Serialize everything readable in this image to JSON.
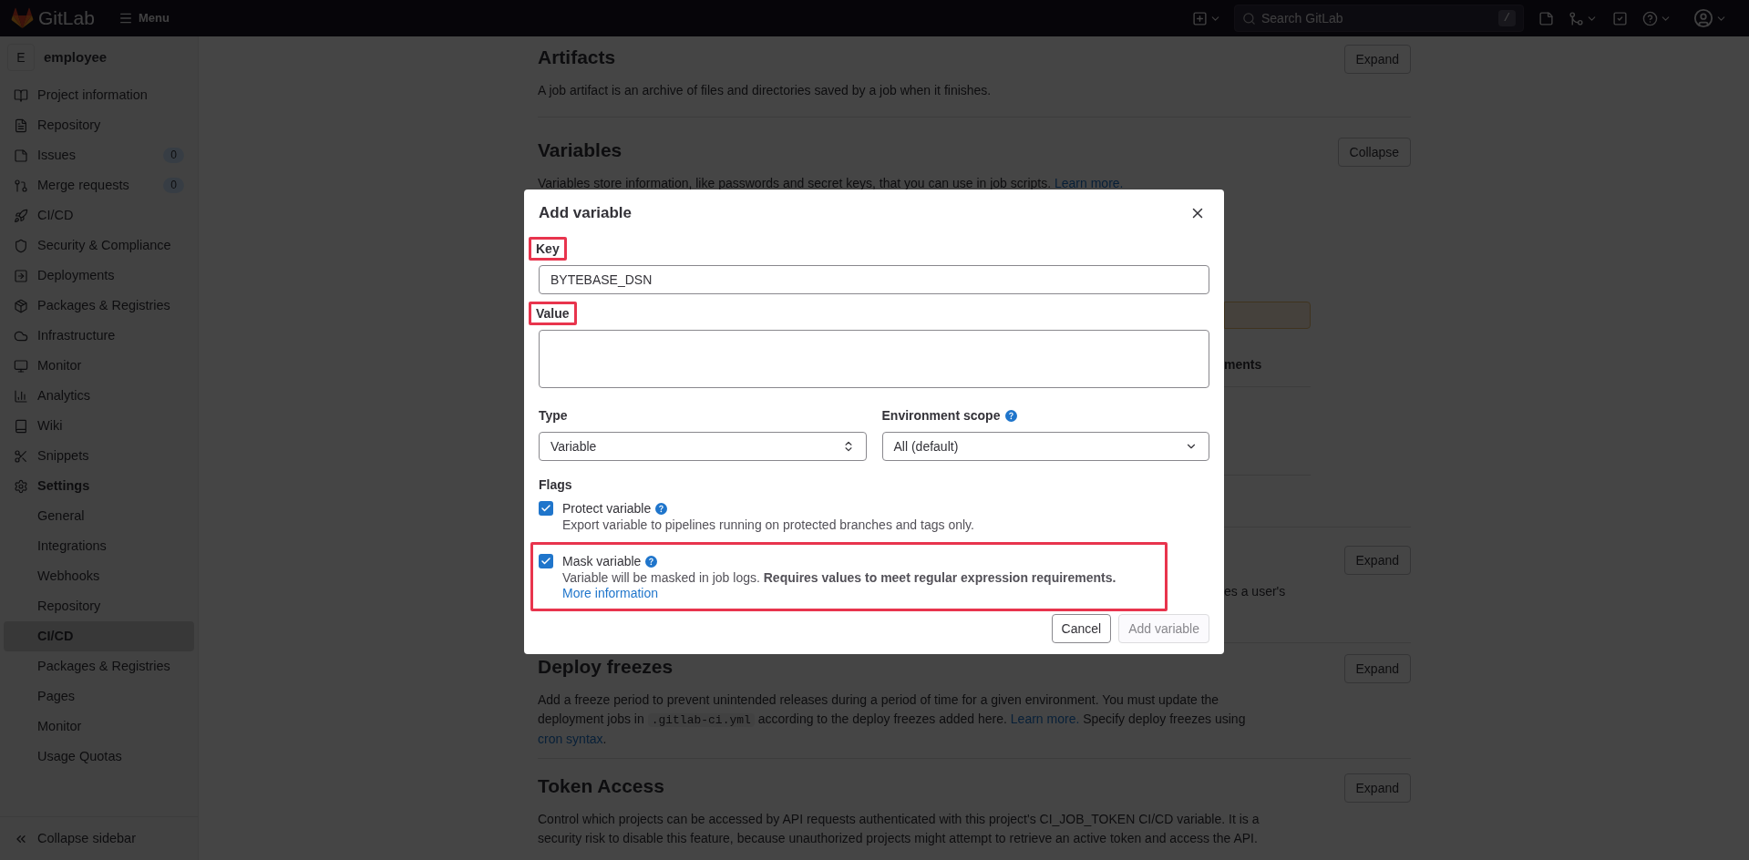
{
  "top_bar": {
    "logo": "GitLab",
    "menu": "Menu",
    "search": {
      "placeholder": "Search GitLab",
      "shortcut": "/"
    }
  },
  "sidebar": {
    "project_initial": "E",
    "project_name": "employee",
    "items": [
      {
        "label": "Project information",
        "selected": false
      },
      {
        "label": "Repository",
        "selected": false
      },
      {
        "label": "Issues",
        "badge": "0",
        "selected": false
      },
      {
        "label": "Merge requests",
        "badge": "0",
        "selected": false
      },
      {
        "label": "CI/CD",
        "selected": false
      },
      {
        "label": "Security & Compliance",
        "selected": false
      },
      {
        "label": "Deployments",
        "selected": false
      },
      {
        "label": "Packages & Registries",
        "selected": false
      },
      {
        "label": "Infrastructure",
        "selected": false
      },
      {
        "label": "Monitor",
        "selected": false
      },
      {
        "label": "Analytics",
        "selected": false
      },
      {
        "label": "Wiki",
        "selected": false
      },
      {
        "label": "Snippets",
        "selected": false
      },
      {
        "label": "Settings",
        "expanded": true,
        "children": [
          {
            "label": "General",
            "selected": false
          },
          {
            "label": "Integrations",
            "selected": false
          },
          {
            "label": "Webhooks",
            "selected": false
          },
          {
            "label": "Repository",
            "selected": false
          },
          {
            "label": "CI/CD",
            "selected": true
          },
          {
            "label": "Packages & Registries",
            "selected": false
          },
          {
            "label": "Pages",
            "selected": false
          },
          {
            "label": "Monitor",
            "selected": false
          },
          {
            "label": "Usage Quotas",
            "selected": false
          }
        ]
      }
    ],
    "collapse": "Collapse sidebar"
  },
  "sections": [
    {
      "kind": "full",
      "title": "Artifacts",
      "button": "Expand",
      "description": [
        {
          "kind": "text",
          "text": "A job artifact is an archive of files and directories saved by a job when it finishes."
        }
      ]
    },
    {
      "kind": "variables",
      "title": "Variables",
      "button": "Collapse",
      "description": [
        {
          "kind": "text",
          "text": "Variables store information, like passwords and secret keys, that you can use in job scripts. "
        },
        {
          "kind": "link",
          "text": "Learn more."
        }
      ],
      "column_fragment": "ments"
    },
    {
      "kind": "covered",
      "button": "Expand",
      "description_fragment": "es a user's"
    },
    {
      "kind": "full",
      "title": "Deploy freezes",
      "button": "Expand",
      "description": [
        {
          "kind": "text",
          "text": "Add a freeze period to prevent unintended releases during a period of time for a given environment. You must update the deployment jobs in "
        },
        {
          "kind": "code",
          "text": ".gitlab-ci.yml"
        },
        {
          "kind": "text",
          "text": " according to the deploy freezes added here. "
        },
        {
          "kind": "link",
          "text": "Learn more."
        },
        {
          "kind": "text",
          "text": " Specify deploy freezes using "
        },
        {
          "kind": "link",
          "text": "cron syntax"
        },
        {
          "kind": "text",
          "text": "."
        }
      ]
    },
    {
      "kind": "full",
      "title": "Token Access",
      "button": "Expand",
      "description": [
        {
          "kind": "text",
          "text": "Control which projects can be accessed by API requests authenticated with this project's CI_JOB_TOKEN CI/CD variable. It is a security risk to disable this feature, because unauthorized projects might attempt to retrieve an active token and access the API."
        }
      ]
    }
  ],
  "dialog": {
    "title": "Add variable",
    "key": {
      "label": "Key",
      "value": "BYTEBASE_DSN",
      "highlighted": true
    },
    "value": {
      "label": "Value",
      "highlighted": true
    },
    "type": {
      "label": "Type",
      "value": "Variable"
    },
    "scope": {
      "label": "Environment scope",
      "value": "All (default)"
    },
    "flags_label": "Flags",
    "flags": [
      {
        "label": "Protect variable",
        "checked": true,
        "highlighted": false,
        "description": "Export variable to pipelines running on protected branches and tags only."
      },
      {
        "label": "Mask variable",
        "checked": true,
        "highlighted": true,
        "description": "Variable will be masked in job logs. **Requires values to meet regular expression requirements.** ",
        "link": "More information"
      }
    ],
    "buttons": [
      {
        "label": "Cancel",
        "disabled": false
      },
      {
        "label": "Add variable",
        "disabled": true
      }
    ]
  }
}
